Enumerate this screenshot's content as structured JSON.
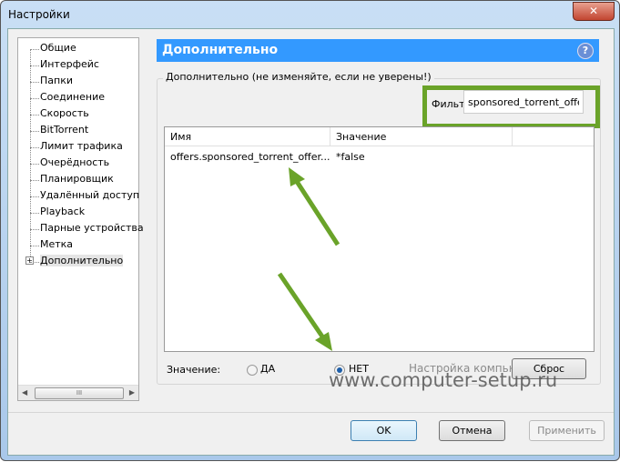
{
  "window": {
    "title": "Настройки",
    "close_icon": "close-icon"
  },
  "sidebar": {
    "items": [
      {
        "label": "Общие"
      },
      {
        "label": "Интерфейс"
      },
      {
        "label": "Папки"
      },
      {
        "label": "Соединение"
      },
      {
        "label": "Скорость"
      },
      {
        "label": "BitTorrent"
      },
      {
        "label": "Лимит трафика"
      },
      {
        "label": "Очерёдность"
      },
      {
        "label": "Планировщик"
      },
      {
        "label": "Удалённый доступ"
      },
      {
        "label": "Playback"
      },
      {
        "label": "Парные устройства"
      },
      {
        "label": "Метка"
      },
      {
        "label": "Дополнительно",
        "selected": true
      }
    ],
    "scroll_grip": "III"
  },
  "header": {
    "title": "Дополнительно",
    "help": "?"
  },
  "group": {
    "label": "Дополнительно (не изменяйте, если не уверены!)",
    "filter_label": "Фильтр",
    "filter_value": "sponsored_torrent_offer",
    "columns": [
      "Имя",
      "Значение"
    ],
    "rows": [
      {
        "name": "offers.sponsored_torrent_offer...",
        "value": "*false"
      }
    ],
    "value_label": "Значение:",
    "yes": "ДА",
    "no": "НЕТ",
    "selected": "НЕТ",
    "reset": "Сброс"
  },
  "footer": {
    "ok": "OK",
    "cancel": "Отмена",
    "apply": "Применить"
  },
  "watermark": {
    "line1": "Настройка компьютера",
    "line2": "www.computer-setup.ru"
  },
  "colors": {
    "accent": "#3399ff",
    "annotation": "#6aa329"
  }
}
